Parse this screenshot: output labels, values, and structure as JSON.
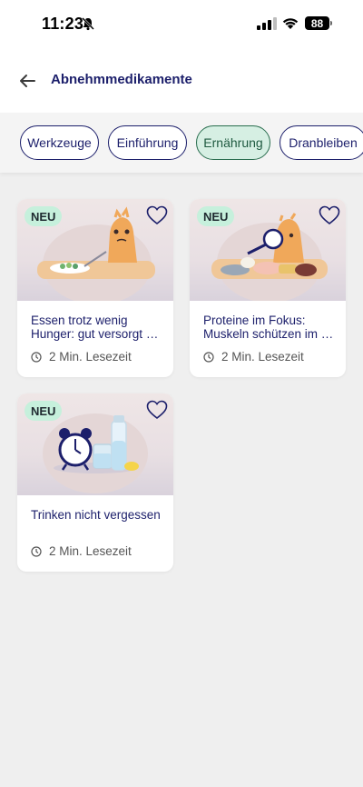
{
  "status": {
    "time": "11:23",
    "battery": "88"
  },
  "header": {
    "title": "Abnehmmedikamente"
  },
  "chips": [
    {
      "label": "Werkzeuge",
      "active": false
    },
    {
      "label": "Einführung",
      "active": false
    },
    {
      "label": "Ernährung",
      "active": true
    },
    {
      "label": "Dranbleiben",
      "active": false
    }
  ],
  "cards": [
    {
      "badge": "NEU",
      "title": "Essen trotz wenig Hunger: gut versorgt …",
      "meta": "2 Min. Lesezeit",
      "image_icon": "character-eating-salad"
    },
    {
      "badge": "NEU",
      "title": "Proteine im Fokus: Muskeln schützen im …",
      "meta": "2 Min. Lesezeit",
      "image_icon": "character-magnifier-protein-foods"
    },
    {
      "badge": "NEU",
      "title": "Trinken nicht vergessen",
      "meta": "2 Min. Lesezeit",
      "image_icon": "clock-glass-bottle"
    }
  ],
  "colors": {
    "accent": "#1c1f6b",
    "chip_active_bg": "#d6efe3",
    "badge_bg": "#c6f0dc",
    "page_bg": "#efefef"
  }
}
